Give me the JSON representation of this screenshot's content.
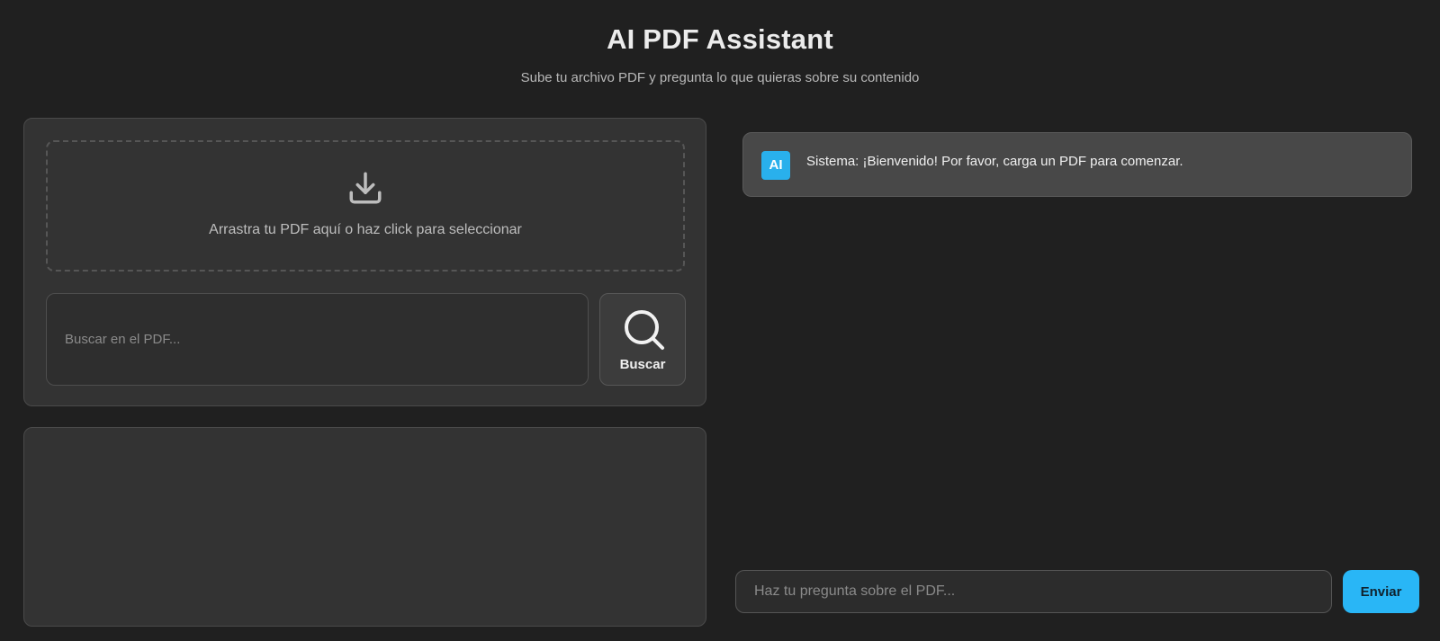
{
  "header": {
    "title": "AI PDF Assistant",
    "subtitle": "Sube tu archivo PDF y pregunta lo que quieras sobre su contenido"
  },
  "upload": {
    "icon": "download-icon",
    "text": "Arrastra tu PDF aquí o haz click para seleccionar"
  },
  "search": {
    "placeholder": "Buscar en el PDF...",
    "button_label": "Buscar",
    "button_icon": "search-icon"
  },
  "chat": {
    "messages": [
      {
        "badge": "AI",
        "text": "Sistema: ¡Bienvenido! Por favor, carga un PDF para comenzar."
      }
    ],
    "input_placeholder": "Haz tu pregunta sobre el PDF...",
    "send_label": "Enviar"
  },
  "colors": {
    "background": "#202020",
    "panel": "#333333",
    "accent": "#29b6f6",
    "message_bg": "#484848"
  }
}
